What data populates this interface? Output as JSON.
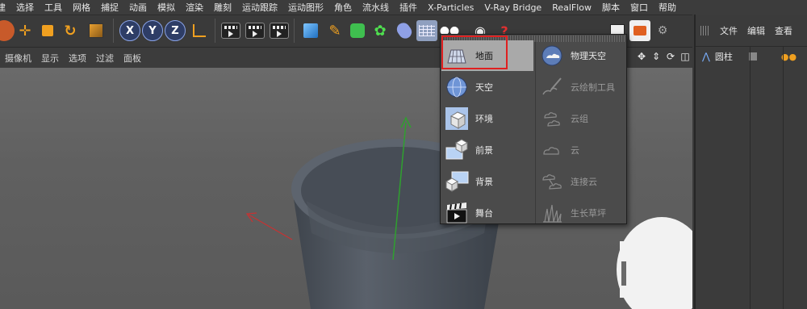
{
  "menubar": {
    "items": [
      "建",
      "选择",
      "工具",
      "网格",
      "捕捉",
      "动画",
      "模拟",
      "渲染",
      "雕刻",
      "运动跟踪",
      "运动图形",
      "角色",
      "流水线",
      "插件",
      "X-Particles",
      "V-Ray Bridge",
      "RealFlow",
      "脚本",
      "窗口",
      "帮助"
    ]
  },
  "toolbar": {
    "axis_x": "X",
    "axis_y": "Y",
    "axis_z": "Z"
  },
  "viewport_menu": {
    "items": [
      "摄像机",
      "显示",
      "选项",
      "过滤",
      "面板"
    ]
  },
  "right_panel": {
    "tabs": [
      "文件",
      "编辑",
      "查看"
    ],
    "object_name": "圆柱"
  },
  "popup": {
    "left_items": [
      {
        "label": "地面",
        "icon": "floor-icon"
      },
      {
        "label": "天空",
        "icon": "sky-icon"
      },
      {
        "label": "环境",
        "icon": "environment-icon"
      },
      {
        "label": "前景",
        "icon": "foreground-icon"
      },
      {
        "label": "背景",
        "icon": "background-icon"
      },
      {
        "label": "舞台",
        "icon": "stage-icon"
      }
    ],
    "right_items": [
      {
        "label": "物理天空",
        "icon": "physical-sky-icon"
      },
      {
        "label": "云绘制工具",
        "icon": "cloud-paint-tool-icon"
      },
      {
        "label": "云组",
        "icon": "cloud-group-icon"
      },
      {
        "label": "云",
        "icon": "cloud-icon"
      },
      {
        "label": "连接云",
        "icon": "connect-clouds-icon"
      },
      {
        "label": "生长草坪",
        "icon": "grow-grass-icon"
      }
    ],
    "selected": "地面"
  },
  "colors": {
    "highlight_border": "#e02020",
    "y_axis": "#2fa02f",
    "x_axis": "#c83232",
    "cup": "#4e5560"
  }
}
